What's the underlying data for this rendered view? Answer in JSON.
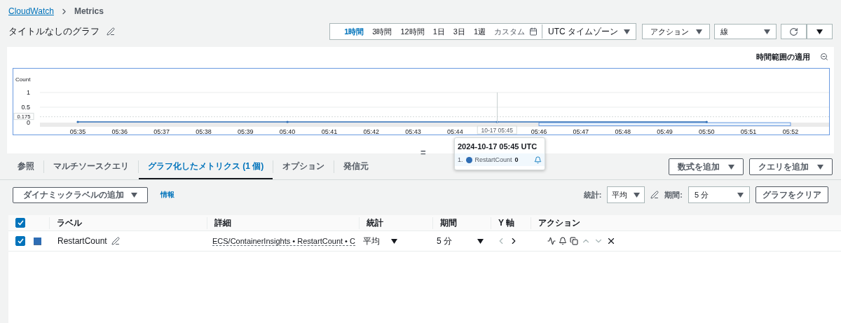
{
  "breadcrumb": [
    {
      "label": "CloudWatch",
      "link": true
    },
    {
      "label": "Metrics",
      "link": false
    }
  ],
  "title": "タイトルなしのグラフ",
  "time_ranges": [
    {
      "label": "1時間",
      "selected": true
    },
    {
      "label": "3時間",
      "selected": false
    },
    {
      "label": "12時間",
      "selected": false
    },
    {
      "label": "1日",
      "selected": false
    },
    {
      "label": "3日",
      "selected": false
    },
    {
      "label": "1週",
      "selected": false
    }
  ],
  "custom": "カスタム",
  "timezone": "UTC タイムゾーン",
  "actions": "アクション",
  "chart_type": "線",
  "apply_time_range": "時間範囲の適用",
  "graph": {
    "chart_data": {
      "type": "line",
      "ylabel": "Count",
      "ylim": [
        0,
        1
      ],
      "yticks": [
        0,
        0.5,
        1
      ],
      "categories": [
        "05:35",
        "05:36",
        "05:37",
        "05:38",
        "05:39",
        "05:40",
        "05:41",
        "05:42",
        "05:43",
        "05:44",
        null,
        "05:46",
        "05:47",
        "05:48",
        "05:49",
        "05:50",
        "05:51",
        "05:52"
      ],
      "series": [
        {
          "name": "RestartCount",
          "color": "#2e6db4",
          "values": [
            0,
            0,
            0,
            0,
            0,
            0,
            0,
            0,
            0,
            0,
            0,
            0,
            0,
            0,
            0,
            0,
            null,
            null
          ]
        }
      ],
      "ref_lines": [
        {
          "axis": "y",
          "value": 0.175,
          "label": "0.175"
        },
        {
          "axis": "y",
          "value": 0.5
        }
      ]
    },
    "crosshair_label": "10-17 05:45",
    "tooltip": {
      "time": "2024-10-17 05:45 UTC",
      "rows": [
        {
          "index": "1.",
          "value": "0"
        }
      ]
    }
  },
  "drag_handle": "=",
  "tabs": [
    {
      "label": "参照",
      "selected": false
    },
    {
      "label": "マルチソースクエリ",
      "selected": false
    },
    {
      "label": "グラフ化したメトリクス (1 個)",
      "selected": true
    },
    {
      "label": "オプション",
      "selected": false
    },
    {
      "label": "発信元",
      "selected": false
    }
  ],
  "add_math": "数式を追加",
  "add_query": "クエリを追加",
  "dynamic_label": "ダイナミックラベルの追加",
  "info": "情報",
  "stat": {
    "label": "統計:",
    "value": "平均"
  },
  "period": {
    "label": "期間:",
    "value": "5 分"
  },
  "clear": "グラフをクリア",
  "table": {
    "all_checked": true,
    "columns": [
      "ラベル",
      "詳細",
      "統計",
      "期間",
      "Y 軸",
      "アクション"
    ],
    "rows": [
      {
        "checked": true,
        "color": "#2e6db4",
        "label": "RestartCount",
        "details": "ECS/ContainerInsights • RestartCount • C",
        "stat": "平均",
        "period": "5 分"
      }
    ]
  }
}
